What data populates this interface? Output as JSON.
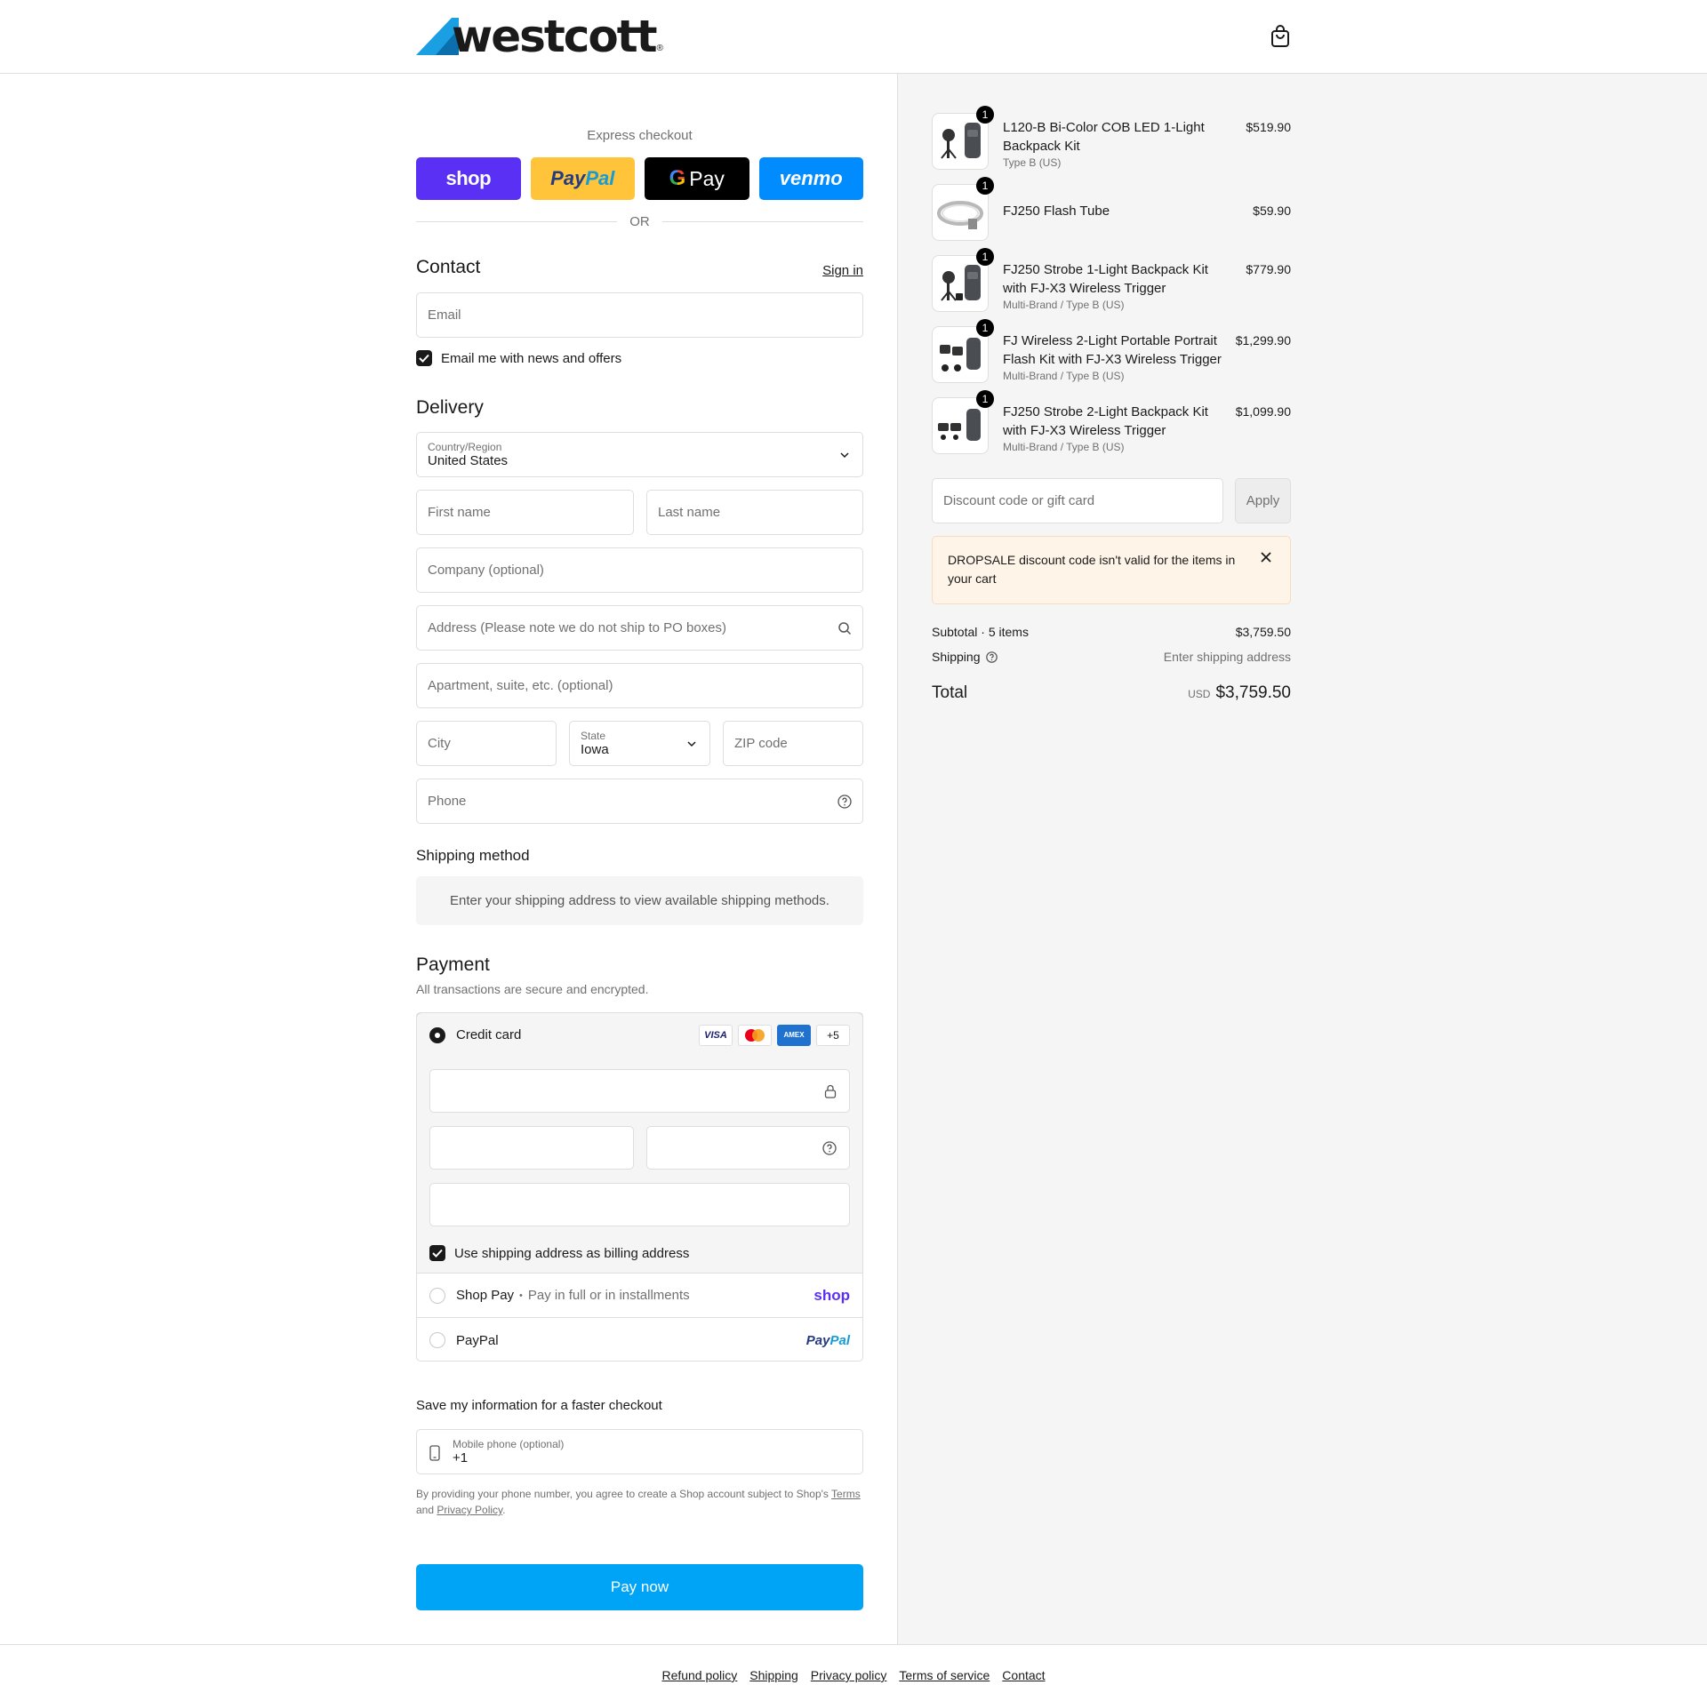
{
  "brand": {
    "name": "westcott",
    "reg": "®",
    "color": "#1a1a1a",
    "accent": "#1b9fe3"
  },
  "header": {
    "cart_icon": "shopping-bag-icon"
  },
  "express": {
    "title": "Express checkout",
    "buttons": [
      "shop",
      "PayPal",
      "Pay",
      "venmo"
    ],
    "or": "OR"
  },
  "contact": {
    "title": "Contact",
    "sign_in": "Sign in",
    "email_placeholder": "Email",
    "news_label": "Email me with news and offers"
  },
  "delivery": {
    "title": "Delivery",
    "country_label": "Country/Region",
    "country_value": "United States",
    "first_name": "First name",
    "last_name": "Last name",
    "company": "Company (optional)",
    "address": "Address (Please note we do not ship to PO boxes)",
    "apartment": "Apartment, suite, etc. (optional)",
    "city": "City",
    "state_label": "State",
    "state_value": "Iowa",
    "zip": "ZIP code",
    "phone": "Phone"
  },
  "shipping_method": {
    "title": "Shipping method",
    "notice": "Enter your shipping address to view available shipping methods."
  },
  "payment": {
    "title": "Payment",
    "subtitle": "All transactions are secure and encrypted.",
    "credit_card": "Credit card",
    "cards": [
      "VISA",
      "mastercard",
      "AMEX",
      "+5"
    ],
    "billing_same": "Use shipping address as billing address",
    "shop_pay": "Shop Pay",
    "shop_pay_sep": "•",
    "shop_pay_desc": "Pay in full or in installments",
    "shop_logo": "shop",
    "paypal": "PayPal",
    "paypal_logo_1": "Pay",
    "paypal_logo_2": "Pal"
  },
  "save_info": {
    "title": "Save my information for a faster checkout",
    "mobile_label": "Mobile phone (optional)",
    "mobile_value": "+1",
    "legal_1": "By providing your phone number, you agree to create a Shop account subject to Shop's",
    "terms": "Terms",
    "legal_and": "and",
    "privacy": "Privacy Policy",
    "legal_end": "."
  },
  "pay_now": "Pay now",
  "colors": {
    "pay_now": "#00a4f6",
    "shop": "#5a31f4",
    "paypal": "#ffc439",
    "gpay": "#000000",
    "venmo": "#008cff"
  },
  "cart": {
    "items": [
      {
        "qty": "1",
        "name": "L120-B Bi-Color COB LED 1-Light Backpack Kit",
        "variant": "Type B (US)",
        "price": "$519.90"
      },
      {
        "qty": "1",
        "name": "FJ250 Flash Tube",
        "variant": "",
        "price": "$59.90"
      },
      {
        "qty": "1",
        "name": "FJ250 Strobe 1-Light Backpack Kit with FJ-X3 Wireless Trigger",
        "variant": "Multi-Brand / Type B (US)",
        "price": "$779.90"
      },
      {
        "qty": "1",
        "name": "FJ Wireless 2-Light Portable Portrait Flash Kit with FJ-X3 Wireless Trigger",
        "variant": "Multi-Brand / Type B (US)",
        "price": "$1,299.90"
      },
      {
        "qty": "1",
        "name": "FJ250 Strobe 2-Light Backpack Kit with FJ-X3 Wireless Trigger",
        "variant": "Multi-Brand / Type B (US)",
        "price": "$1,099.90"
      }
    ],
    "discount_placeholder": "Discount code or gift card",
    "apply": "Apply",
    "alert": "DROPSALE discount code isn't valid for the items in your cart",
    "subtotal_label": "Subtotal · 5 items",
    "subtotal_value": "$3,759.50",
    "shipping_label": "Shipping",
    "shipping_value": "Enter shipping address",
    "total_label": "Total",
    "currency": "USD",
    "total_value": "$3,759.50"
  },
  "footer": [
    "Refund policy",
    "Shipping",
    "Privacy policy",
    "Terms of service",
    "Contact"
  ]
}
